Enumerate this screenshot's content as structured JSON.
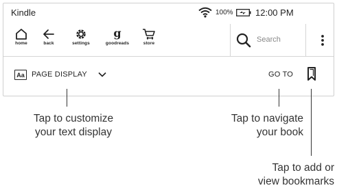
{
  "status_bar": {
    "title": "Kindle",
    "battery": "100%",
    "time": "12:00 PM"
  },
  "toolbar": {
    "items": [
      {
        "label": "home",
        "icon": "home-icon"
      },
      {
        "label": "back",
        "icon": "back-arrow-icon"
      },
      {
        "label": "settings",
        "icon": "gear-icon"
      },
      {
        "label": "goodreads",
        "icon": "goodreads-icon"
      },
      {
        "label": "store",
        "icon": "cart-icon"
      }
    ],
    "search_placeholder": "Search",
    "menu_icon": "vertical-ellipsis-icon"
  },
  "display_bar": {
    "aa_label": "Aa",
    "page_display_label": "PAGE DISPLAY",
    "goto_label": "GO TO",
    "bookmark_icon": "bookmark-icon"
  },
  "callouts": {
    "customize_line1": "Tap to customize",
    "customize_line2": "your text display",
    "navigate_line1": "Tap to navigate",
    "navigate_line2": "your book",
    "bookmarks_line1": "Tap to add or",
    "bookmarks_line2": "view bookmarks"
  }
}
